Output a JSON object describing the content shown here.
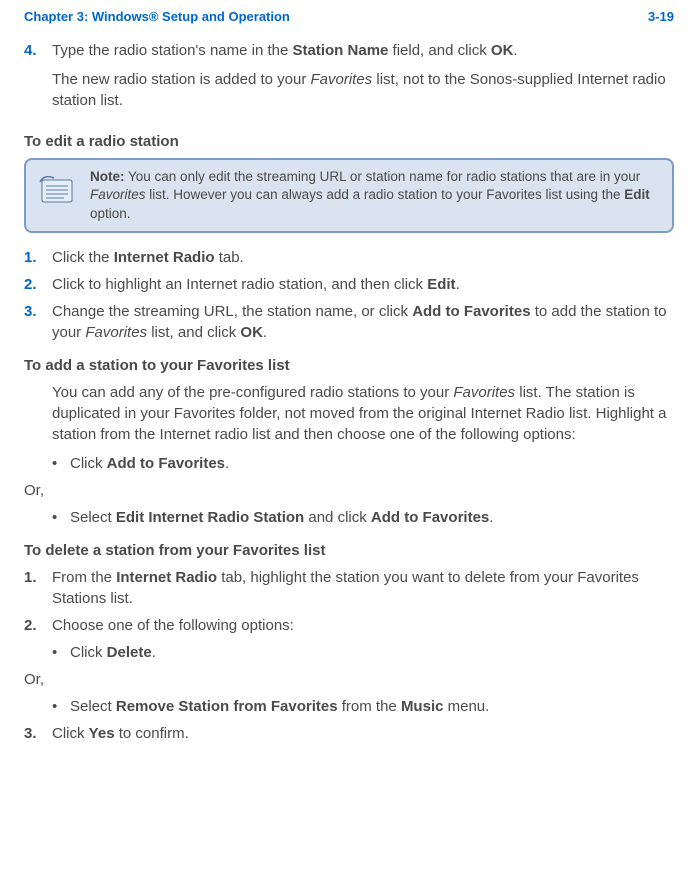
{
  "header": {
    "chapter": "Chapter 3:  Windows® Setup and Operation",
    "page": "3-19"
  },
  "step4": {
    "num": "4.",
    "text_a": "Type the radio station's name in the ",
    "text_b": "Station Name",
    "text_c": " field, and click ",
    "text_d": "OK",
    "text_e": ".",
    "para2_a": "The new radio station is added to your ",
    "para2_b": "Favorites",
    "para2_c": " list, not to the Sonos-supplied Internet radio station list."
  },
  "edit_heading": "To edit a radio station",
  "note": {
    "label": "Note:",
    "text_a": "   You can only edit the streaming URL or station name for radio stations that are in your ",
    "text_b": "Favorites",
    "text_c": " list. However you can always add a radio station to your Favorites list using the ",
    "text_d": "Edit",
    "text_e": " option."
  },
  "edit_steps": {
    "s1": {
      "num": "1.",
      "a": "Click the ",
      "b": "Internet Radio",
      "c": " tab."
    },
    "s2": {
      "num": "2.",
      "a": "Click to highlight an Internet radio station, and then click ",
      "b": "Edit",
      "c": "."
    },
    "s3": {
      "num": "3.",
      "a": "Change the streaming URL, the station name, or click ",
      "b": "Add to Favorites",
      "c": " to add the station to your ",
      "d": "Favorites",
      "e": " list, and click ",
      "f": "OK",
      "g": "."
    }
  },
  "add_heading": "To add a station to your Favorites list",
  "add_para": {
    "a": "You can add any of the pre-configured radio stations to your ",
    "b": "Favorites",
    "c": " list. The station is duplicated in your Favorites folder, not moved from the original Internet Radio list. Highlight a station from the Internet radio list and then choose one of the following options:"
  },
  "add_bullet1": {
    "a": "Click ",
    "b": "Add to Favorites",
    "c": "."
  },
  "or": "Or,",
  "add_bullet2": {
    "a": "Select ",
    "b": "Edit Internet Radio Station",
    "c": " and click ",
    "d": "Add to Favorites",
    "e": "."
  },
  "delete_heading": "To delete a station from your Favorites list",
  "delete_steps": {
    "s1": {
      "num": "1.",
      "a": "From the ",
      "b": "Internet Radio",
      "c": " tab, highlight the station you want to delete from your Favorites Stations list."
    },
    "s2": {
      "num": "2.",
      "a": "Choose one of the following options:"
    },
    "b1": {
      "a": "Click ",
      "b": "Delete",
      "c": "."
    },
    "b2": {
      "a": "Select ",
      "b": "Remove Station from Favorites",
      "c": " from the ",
      "d": "Music",
      "e": " menu."
    },
    "s3": {
      "num": "3.",
      "a": "Click ",
      "b": "Yes",
      "c": " to confirm."
    }
  }
}
